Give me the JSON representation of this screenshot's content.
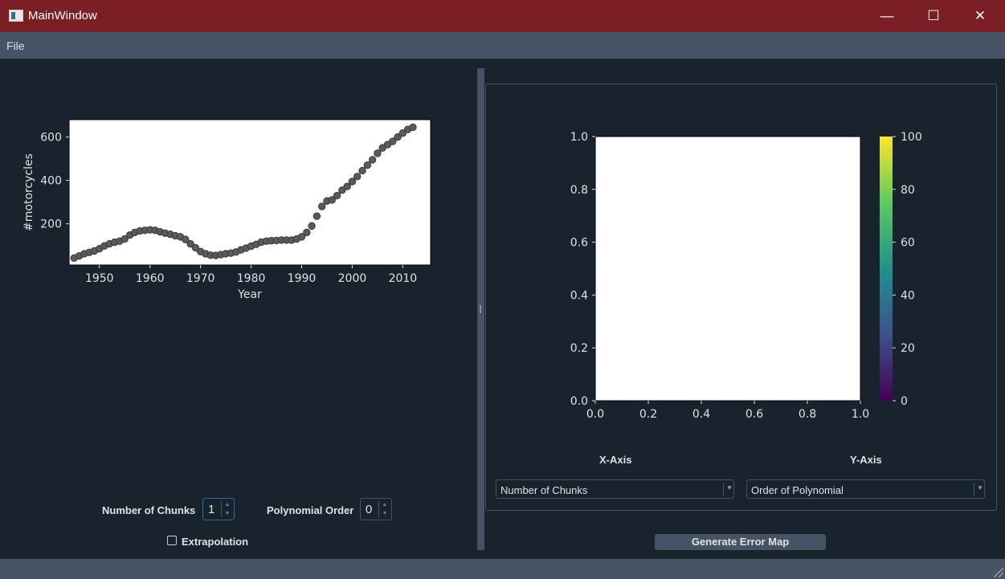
{
  "window": {
    "title": "MainWindow",
    "minimize": "—",
    "maximize": "☐",
    "close": "✕"
  },
  "menu": {
    "file": "File"
  },
  "left_panel": {
    "chunks_label": "Number of Chunks",
    "chunks_value": "1",
    "poly_label": "Polynomial Order",
    "poly_value": "0",
    "extrapolation_label": "Extrapolation",
    "extrapolation_checked": false
  },
  "right_panel": {
    "xaxis_label": "X-Axis",
    "yaxis_label": "Y-Axis",
    "xaxis_selected": "Number of Chunks",
    "yaxis_selected": "Order of Polynomial",
    "generate_button": "Generate Error Map"
  },
  "chart_data": [
    {
      "type": "scatter",
      "xlabel": "Year",
      "ylabel": "#motorcycles",
      "xlim": [
        1944,
        2015.5
      ],
      "ylim": [
        10,
        680
      ],
      "xticks": [
        1950,
        1960,
        1970,
        1980,
        1990,
        2000,
        2010
      ],
      "yticks": [
        200,
        400,
        600
      ],
      "marker_color": "#5a5a5a",
      "x": [
        1945,
        1946,
        1947,
        1948,
        1949,
        1950,
        1951,
        1952,
        1953,
        1954,
        1955,
        1956,
        1957,
        1958,
        1959,
        1960,
        1961,
        1962,
        1963,
        1964,
        1965,
        1966,
        1967,
        1968,
        1969,
        1970,
        1971,
        1972,
        1973,
        1974,
        1975,
        1976,
        1977,
        1978,
        1979,
        1980,
        1981,
        1982,
        1983,
        1984,
        1985,
        1986,
        1987,
        1988,
        1989,
        1990,
        1991,
        1992,
        1993,
        1994,
        1995,
        1996,
        1997,
        1998,
        1999,
        2000,
        2001,
        2002,
        2003,
        2004,
        2005,
        2006,
        2007,
        2008,
        2009,
        2010,
        2011,
        2012
      ],
      "y": [
        42,
        52,
        62,
        68,
        75,
        85,
        98,
        108,
        115,
        120,
        130,
        148,
        160,
        167,
        170,
        172,
        170,
        163,
        157,
        152,
        145,
        140,
        128,
        108,
        90,
        72,
        62,
        55,
        54,
        58,
        62,
        65,
        70,
        80,
        88,
        97,
        105,
        115,
        120,
        122,
        123,
        125,
        125,
        125,
        130,
        140,
        160,
        190,
        235,
        280,
        305,
        310,
        330,
        355,
        372,
        395,
        418,
        445,
        470,
        495,
        525,
        550,
        565,
        580,
        600,
        618,
        635,
        645
      ]
    },
    {
      "type": "heatmap",
      "xlim": [
        0,
        1
      ],
      "ylim": [
        0,
        1
      ],
      "xticks": [
        "0.0",
        "0.2",
        "0.4",
        "0.6",
        "0.8",
        "1.0"
      ],
      "yticks": [
        "0.0",
        "0.2",
        "0.4",
        "0.6",
        "0.8",
        "1.0"
      ],
      "colorbar": {
        "colormap": "viridis",
        "range": [
          0,
          100
        ],
        "ticks": [
          "0",
          "20",
          "40",
          "60",
          "80",
          "100"
        ]
      },
      "values": []
    }
  ]
}
